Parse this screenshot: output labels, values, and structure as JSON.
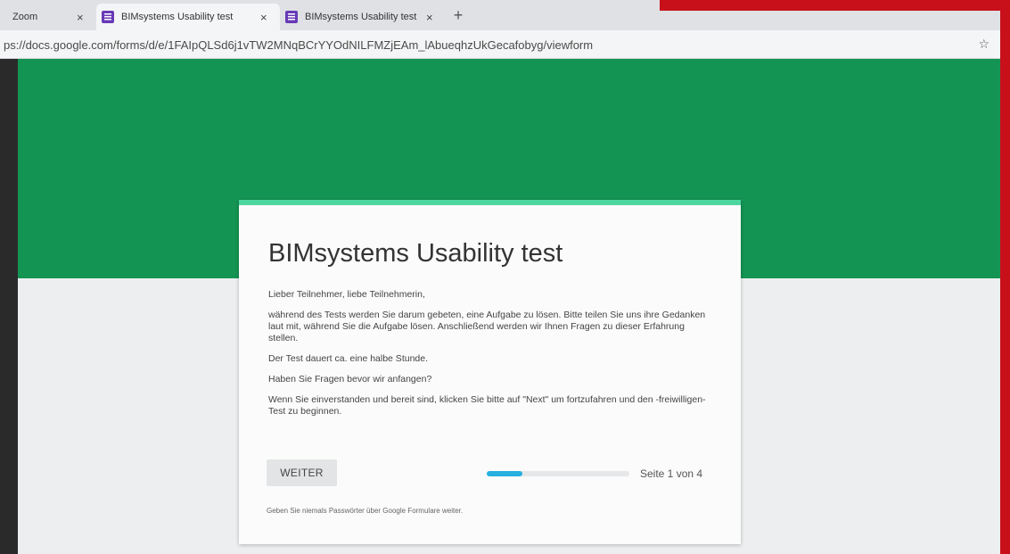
{
  "tabs": [
    {
      "label": "Zoom",
      "close": "×"
    },
    {
      "label": "BIMsystems Usability test",
      "close": "×"
    },
    {
      "label": "BIMsystems Usability test",
      "close": "×"
    }
  ],
  "new_tab": "+",
  "address_bar": {
    "url": "ps://docs.google.com/forms/d/e/1FAIpQLSd6j1vTW2MNqBCrYYOdNILFMZjEAm_lAbueqhzUkGecafobyg/viewform"
  },
  "form": {
    "title": "BIMsystems Usability test",
    "paragraphs": [
      "Lieber Teilnehmer, liebe Teilnehmerin,",
      "während des Tests werden Sie darum gebeten, eine Aufgabe zu lösen. Bitte teilen Sie uns ihre Gedanken laut mit, während Sie die Aufgabe lösen. Anschließend werden wir Ihnen Fragen zu dieser Erfahrung stellen.",
      "Der Test dauert ca. eine halbe Stunde.",
      "Haben Sie Fragen bevor wir anfangen?",
      "Wenn Sie einverstanden und bereit sind, klicken Sie bitte auf \"Next\" um fortzufahren und den -freiwilligen- Test zu beginnen."
    ],
    "next_button": "WEITER",
    "progress_fraction": 0.25,
    "page_indicator": "Seite 1 von 4",
    "footer_note": "Geben Sie niemals Passwörter über Google Formulare weiter."
  },
  "colors": {
    "header_green": "#149453",
    "card_accent": "#4ed6a0",
    "progress": "#27b0e0",
    "forms_icon": "#673ab7"
  }
}
